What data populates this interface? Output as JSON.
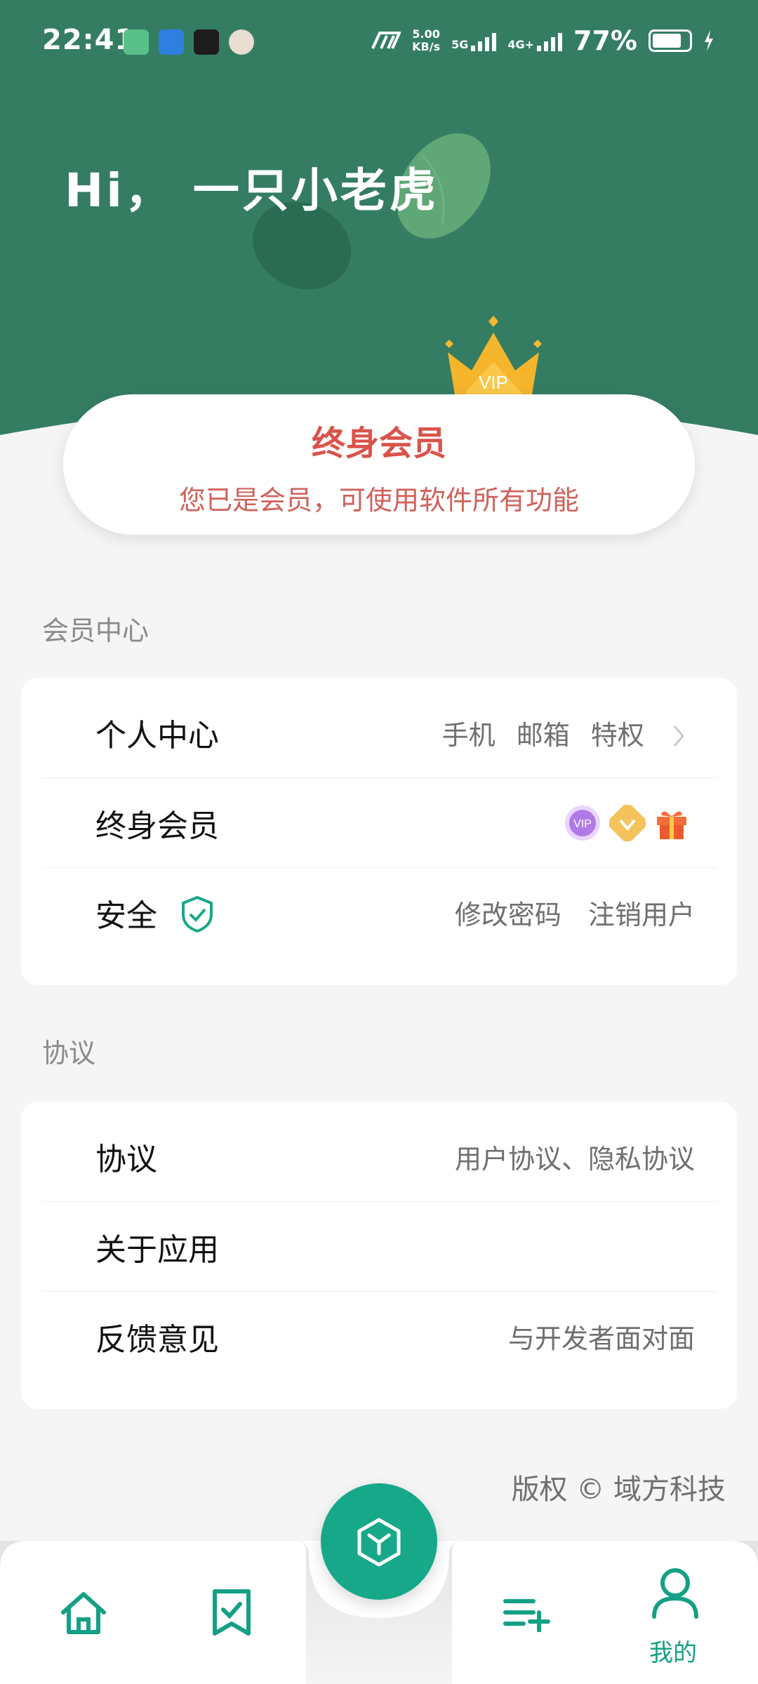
{
  "status_bar": {
    "time": "22:41",
    "net_speed_top": "5.00",
    "net_speed_bottom": "KB/s",
    "net_5g": "5G",
    "net_4g": "4G+",
    "battery": "77%"
  },
  "header": {
    "greeting": "Hi， 一只小老虎",
    "crown_badge": "VIP"
  },
  "member_card": {
    "title": "终身会员",
    "subtitle": "您已是会员，可使用软件所有功能"
  },
  "member_section": {
    "title": "会员中心",
    "items": [
      {
        "label": "个人中心",
        "values": [
          "手机",
          "邮箱",
          "特权"
        ]
      },
      {
        "label": "终身会员",
        "badges": [
          "VIP",
          "diamond-icon",
          "gift-icon"
        ]
      },
      {
        "label": "安全",
        "values": [
          "修改密码",
          "注销用户"
        ]
      }
    ]
  },
  "agreement_section": {
    "title": "协议",
    "items": [
      {
        "label": "协议",
        "value": "用户协议、隐私协议"
      },
      {
        "label": "关于应用",
        "value": ""
      },
      {
        "label": "反馈意见",
        "value": "与开发者面对面"
      }
    ]
  },
  "footer": {
    "copyright": "版权 © 域方科技"
  },
  "nav": {
    "items": [
      "home-icon",
      "bookmark-check-icon",
      "cube-icon",
      "playlist-add-icon",
      "user-icon"
    ],
    "active_label": "我的"
  },
  "colors": {
    "header_green": "#347d62",
    "accent_teal": "#17a889",
    "member_red": "#d9534a"
  }
}
